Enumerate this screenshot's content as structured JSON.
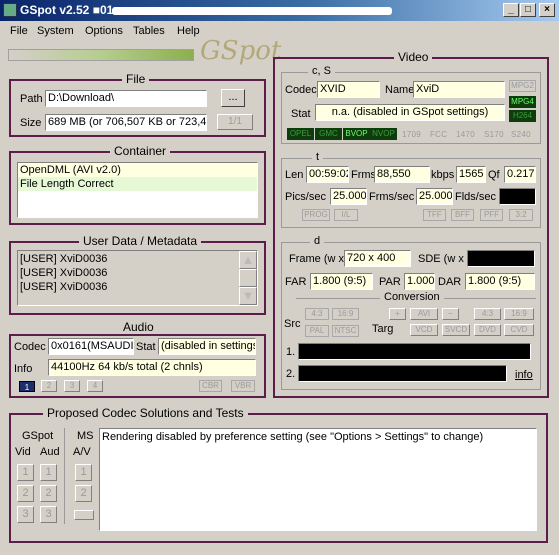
{
  "window": {
    "title": "GSpot v2.52 ■01:"
  },
  "menu": [
    "File",
    "System",
    "Options",
    "Tables",
    "Help"
  ],
  "logo": "GSpot",
  "file": {
    "title": "File",
    "path_label": "Path",
    "path_value": "D:\\Download\\",
    "browse": "...",
    "size_label": "Size",
    "size_value": "689 MB (or 706,507 KB or 723,46",
    "part": "1/1"
  },
  "container": {
    "title": "Container",
    "lines": [
      "OpenDML (AVI v2.0)",
      "File Length Correct"
    ]
  },
  "userdata": {
    "title": "User Data / Metadata",
    "rows": [
      "[USER]    XviD0036",
      "[USER]    XviD0036",
      "[USER]    XviD0036"
    ]
  },
  "audio": {
    "title": "Audio",
    "codec_label": "Codec",
    "codec_value": "0x0161(MSAUDIO",
    "stat_label": "Stat",
    "stat_value": "(disabled in settings)",
    "info_label": "Info",
    "info_value": "44100Hz  64 kb/s total (2 chnls)",
    "streams": [
      "1",
      "2",
      "3",
      "4"
    ],
    "flags": [
      "CBR",
      "VBR"
    ]
  },
  "video": {
    "title": "Video",
    "cs": {
      "title": "c, S",
      "codec_label": "Codec",
      "codec_value": "XVID",
      "name_label": "Name",
      "name_value": "XviD",
      "stat_label": "Stat",
      "stat_value": "n.a. (disabled in GSpot settings)",
      "side_flags": [
        "MPG2",
        "MPG4",
        "H264"
      ],
      "bottom_flags": [
        "OPEL",
        "GMC",
        "BVOP",
        "NVOP",
        "1709",
        "FCC",
        "1470",
        "S170",
        "S240"
      ]
    },
    "t": {
      "title": "t",
      "len_label": "Len",
      "len_value": "00:59:02",
      "frms_label": "Frms",
      "frms_value": "88,550",
      "kbps_label": "kbps",
      "kbps_value": "1565",
      "qf_label": "Qf",
      "qf_value": "0.217",
      "pics_label": "Pics/sec",
      "pics_value": "25.000",
      "frms_sec_label": "Frms/sec",
      "frms_sec_value": "25.000",
      "flds_label": "Flds/sec",
      "flags": [
        "PROG",
        "I/L",
        "TFF",
        "BFF",
        "PFF",
        "3:2"
      ]
    },
    "d": {
      "title": "d",
      "frame_label": "Frame (w x",
      "frame_value": "720 x 400",
      "sde_label": "SDE (w x",
      "far_label": "FAR",
      "far_value": "1.800 (9:5)",
      "par_label": "PAR",
      "par_value": "1.000",
      "dar_label": "DAR",
      "dar_value": "1.800 (9:5)",
      "conversion_label": "Conversion",
      "src_label": "Src",
      "targ_label": "Targ",
      "src_flags": [
        "4:3",
        "16:9",
        "PAL",
        "NTSC"
      ],
      "targ_top": [
        "+",
        "AVI",
        "−",
        "4:3",
        "16:9"
      ],
      "targ_bottom": [
        "VCD",
        "SVCD",
        "DVD",
        "CVD"
      ],
      "line1_label": "1.",
      "line2_label": "2.",
      "info_link": "info"
    }
  },
  "proposed": {
    "title": "Proposed Codec Solutions and Tests",
    "gspot_label": "GSpot",
    "ms_label": "MS",
    "vid_label": "Vid",
    "aud_label": "Aud",
    "av_label": "A/V",
    "nums": [
      "1",
      "2",
      "3"
    ],
    "message": "Rendering disabled by preference setting (see \"Options > Settings\" to change)"
  },
  "colors": {
    "frame": "#5c1d4a",
    "panel": "#d4d0c8",
    "yellow": "#ffffe1",
    "green_on": "#6cff6c",
    "titlebar": "#0a246a"
  }
}
